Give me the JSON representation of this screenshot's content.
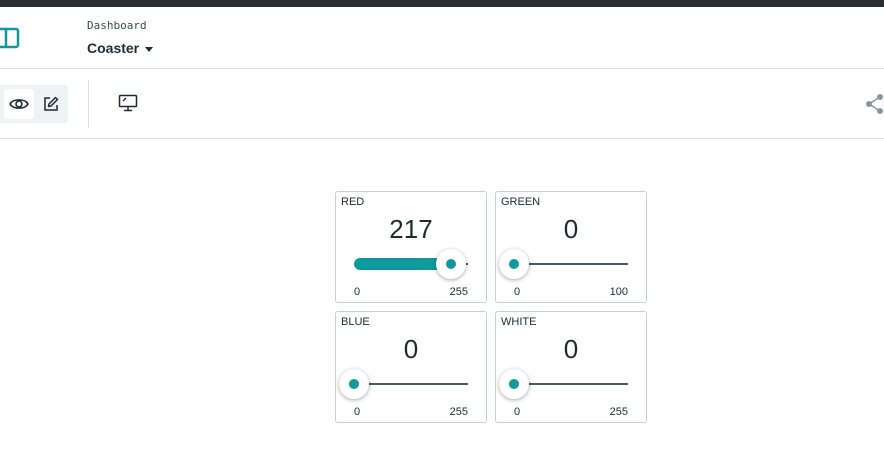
{
  "header": {
    "breadcrumb": "Dashboard",
    "dashboard_name": "Coaster"
  },
  "icons": {
    "sidebar_toggle": "sidebar-icon",
    "view": "eye-icon",
    "edit": "pencil-icon",
    "device_view": "monitor-icon",
    "share": "share-icon",
    "accent_color": "#0f9a9c"
  },
  "widgets": [
    {
      "title": "RED",
      "value": "217",
      "min": "0",
      "max": "255",
      "fraction": 0.851
    },
    {
      "title": "GREEN",
      "value": "0",
      "min": "0",
      "max": "100",
      "fraction": 0
    },
    {
      "title": "BLUE",
      "value": "0",
      "min": "0",
      "max": "255",
      "fraction": 0
    },
    {
      "title": "WHITE",
      "value": "0",
      "min": "0",
      "max": "255",
      "fraction": 0
    }
  ]
}
